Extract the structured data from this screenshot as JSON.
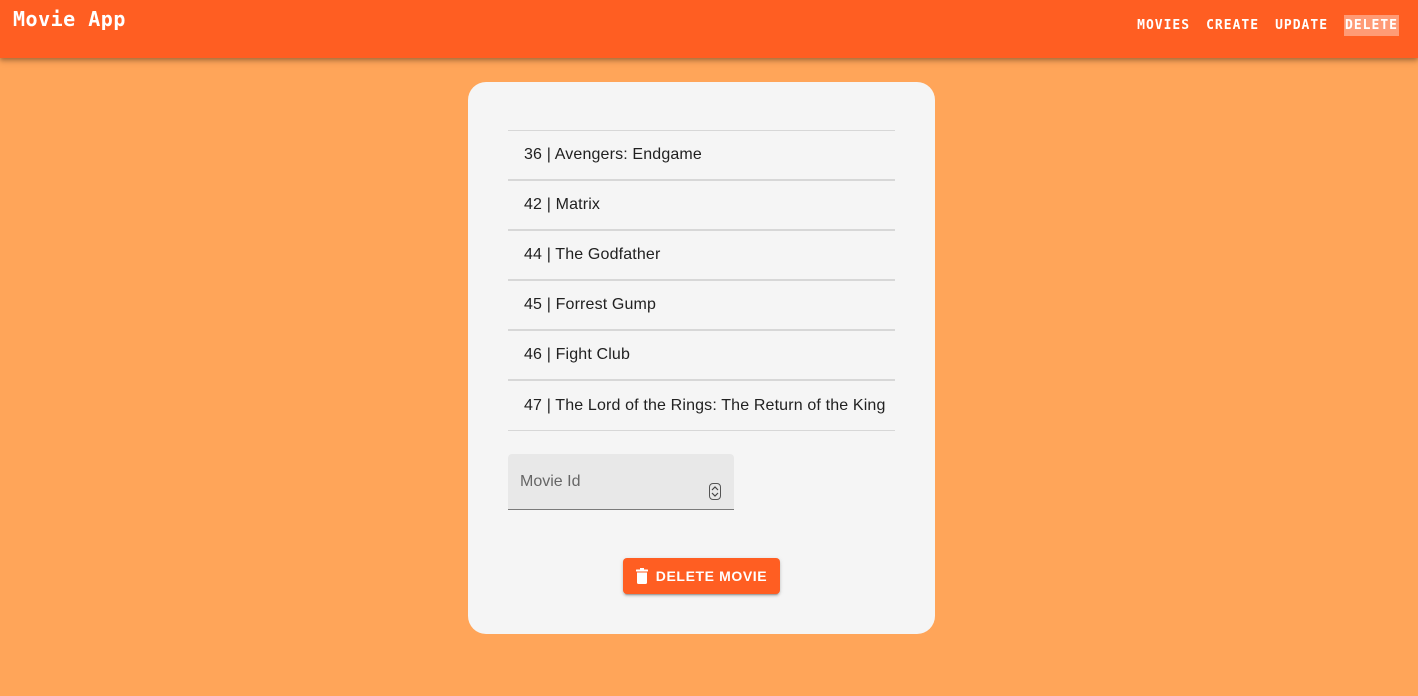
{
  "appbar": {
    "title": "Movie App",
    "nav": [
      {
        "label": "MOVIES"
      },
      {
        "label": "CREATE"
      },
      {
        "label": "UPDATE"
      },
      {
        "label": "DELETE",
        "active": true
      }
    ]
  },
  "movies": [
    {
      "label": "36 | Avengers: Endgame"
    },
    {
      "label": "42 | Matrix"
    },
    {
      "label": "44 | The Godfather"
    },
    {
      "label": "45 | Forrest Gump"
    },
    {
      "label": "46 | Fight Club"
    },
    {
      "label": "47 | The Lord of the Rings: The Return of the King"
    }
  ],
  "form": {
    "movie_id_label": "Movie Id",
    "movie_id_value": "",
    "delete_button_label": "DELETE MOVIE",
    "delete_icon": "trash-icon",
    "spinner_icon": "number-stepper-icon"
  },
  "colors": {
    "appbar": "#FF5E22",
    "background": "#FFA559",
    "card": "#F5F5F5",
    "button": "#FF5E22"
  }
}
